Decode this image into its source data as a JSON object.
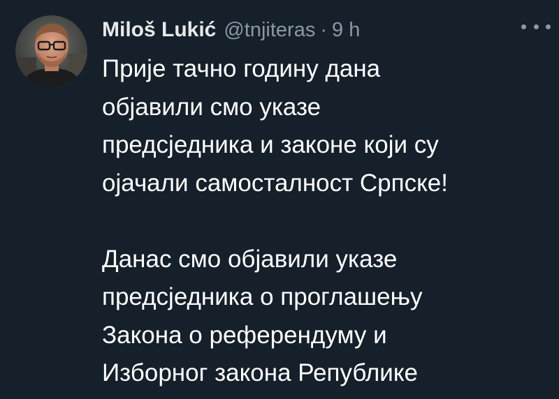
{
  "tweet": {
    "author": {
      "display_name": "Miloš Lukić",
      "handle": "@tnjiteras",
      "separator": "·",
      "time": "9 h"
    },
    "more_icon": "more-horizontal-icon",
    "paragraphs": [
      [
        "Прије тачно годину дана",
        "објавили смо указе",
        "предсједника и законе који су",
        "ојачали самосталност Српске!"
      ],
      [
        "Данас смо објавили указе",
        "предсједника о проглашењу",
        "Закона о референдуму и",
        "Изборног закона Републике"
      ]
    ]
  },
  "colors": {
    "background": "#15202b",
    "text": "#ffffff",
    "muted": "#8b98a5"
  }
}
